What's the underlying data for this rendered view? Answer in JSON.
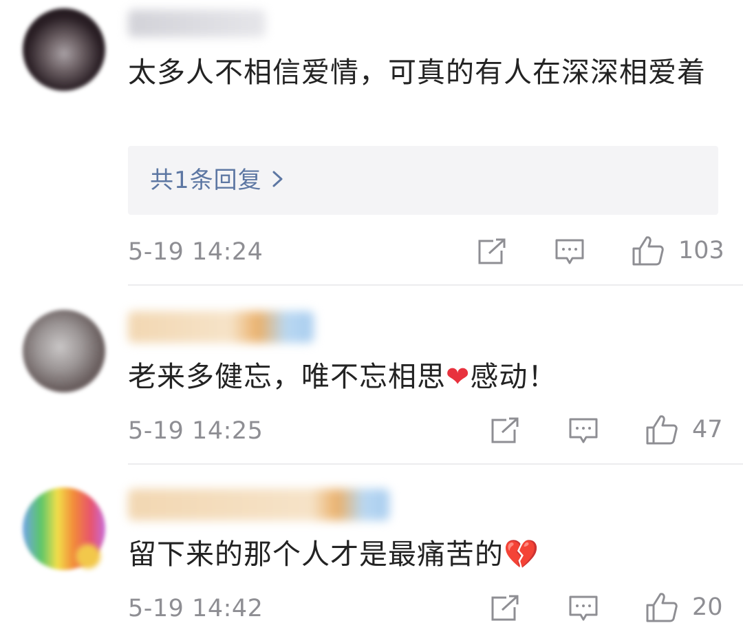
{
  "comments": [
    {
      "text": "太多人不相信爱情，可真的有人在深深相爱着",
      "reply_link": "共1条回复",
      "timestamp": "5-19 14:24",
      "likes": "103"
    },
    {
      "text_before": "老来多健忘，唯不忘相思",
      "emoji": "❤",
      "text_after": "感动！",
      "timestamp": "5-19 14:25",
      "likes": "47"
    },
    {
      "text": "留下来的那个人才是最痛苦的",
      "emoji": "💔",
      "timestamp": "5-19 14:42",
      "likes": "20"
    }
  ],
  "icons": {
    "share": "share-icon",
    "comment": "comment-icon",
    "like": "thumbs-up-icon"
  },
  "colors": {
    "link": "#5d77a3",
    "meta": "#8e8e93",
    "reply_bg": "#f4f4f6"
  }
}
